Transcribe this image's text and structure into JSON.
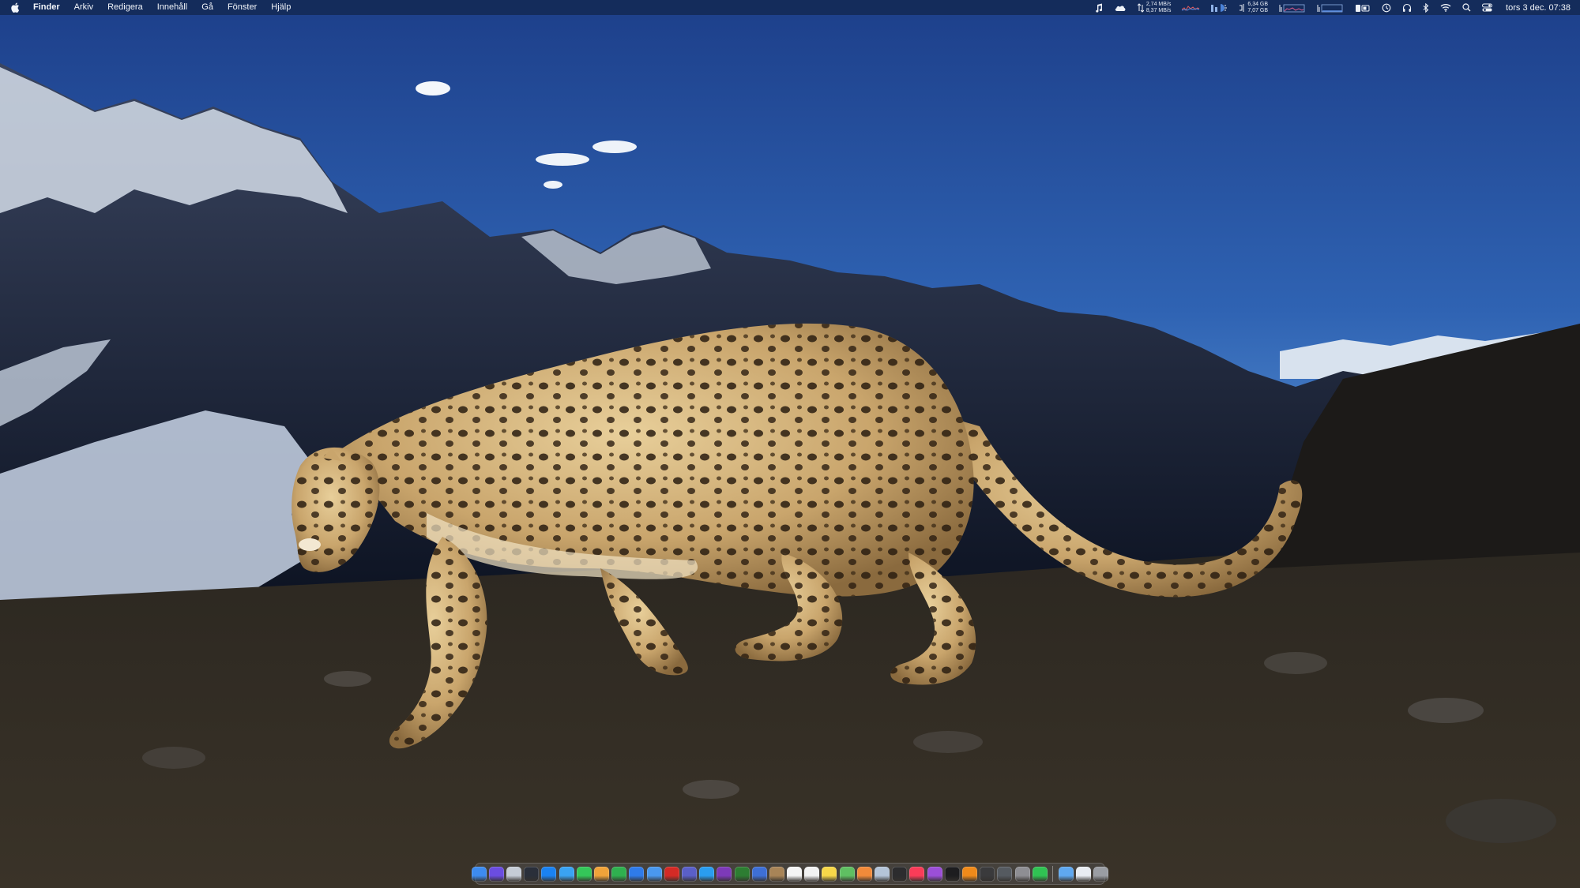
{
  "menubar": {
    "apple_icon": "apple-logo-icon",
    "app_name": "Finder",
    "menus": [
      "Arkiv",
      "Redigera",
      "Innehåll",
      "Gå",
      "Fönster",
      "Hjälp"
    ],
    "network": {
      "up": "2,74 MB/s",
      "down": "8,37 MB/s"
    },
    "disk": {
      "used": "6,34 GB",
      "free": "7,07 GB"
    },
    "clock": "tors 3 dec. 07:38"
  },
  "dock": {
    "apps": [
      {
        "name": "finder",
        "color": "#3d8bf0"
      },
      {
        "name": "siri",
        "color": "#6b4de0"
      },
      {
        "name": "launchpad",
        "color": "#c5ccd6"
      },
      {
        "name": "mission-control",
        "color": "#2a2f3a"
      },
      {
        "name": "app-store",
        "color": "#1a82f2"
      },
      {
        "name": "safari",
        "color": "#3aa3f3"
      },
      {
        "name": "messages",
        "color": "#34c759"
      },
      {
        "name": "pages",
        "color": "#f0a33a"
      },
      {
        "name": "numbers",
        "color": "#2fb14f"
      },
      {
        "name": "keynote",
        "color": "#2f7bea"
      },
      {
        "name": "mail",
        "color": "#4a98ee"
      },
      {
        "name": "acrobat",
        "color": "#d42a25"
      },
      {
        "name": "teams",
        "color": "#5a5fc8"
      },
      {
        "name": "skype",
        "color": "#2a9df0"
      },
      {
        "name": "onenote",
        "color": "#7d3ab8"
      },
      {
        "name": "vim",
        "color": "#2d7d32"
      },
      {
        "name": "mailspring",
        "color": "#3e6fd6"
      },
      {
        "name": "script-editor",
        "color": "#a88457"
      },
      {
        "name": "calendar",
        "color": "#f5f5f5"
      },
      {
        "name": "reminders",
        "color": "#f2f2f2"
      },
      {
        "name": "notes",
        "color": "#f7d749"
      },
      {
        "name": "maps",
        "color": "#5fbf62"
      },
      {
        "name": "photos",
        "color": "#f28a3a"
      },
      {
        "name": "preview",
        "color": "#b4c4d8"
      },
      {
        "name": "voice-memos",
        "color": "#2c2c2e"
      },
      {
        "name": "music",
        "color": "#fa3c58"
      },
      {
        "name": "podcasts",
        "color": "#9b4fd8"
      },
      {
        "name": "apple-tv",
        "color": "#1d1d1f"
      },
      {
        "name": "books",
        "color": "#f08a1a"
      },
      {
        "name": "activity-monitor",
        "color": "#3a3a3c"
      },
      {
        "name": "console",
        "color": "#555a60"
      },
      {
        "name": "system-preferences",
        "color": "#8e8e93"
      },
      {
        "name": "facetime",
        "color": "#30c253"
      }
    ],
    "folders": [
      {
        "name": "downloads-folder",
        "color": "#5fa8f0"
      },
      {
        "name": "documents-stack",
        "color": "#e8ecf2"
      },
      {
        "name": "trash",
        "color": "#9a9da3"
      }
    ]
  }
}
